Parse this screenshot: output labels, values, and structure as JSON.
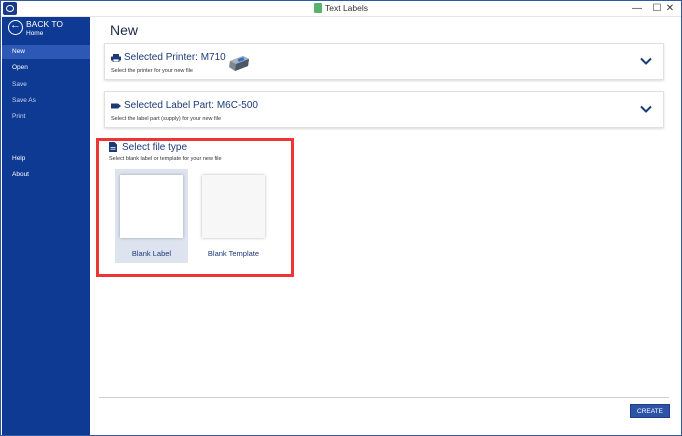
{
  "window": {
    "title": "Text Labels",
    "controls": {
      "minimize": "—",
      "maximize": "☐",
      "close": "✕"
    }
  },
  "sidebar": {
    "back_label": "BACK TO",
    "back_sub": "Home",
    "items": [
      {
        "label": "New",
        "active": true
      },
      {
        "label": "Open",
        "active": false
      },
      {
        "label": "Save",
        "active": false
      },
      {
        "label": "Save As",
        "active": false
      },
      {
        "label": "Print",
        "active": false
      },
      {
        "label": "Help",
        "active": false
      },
      {
        "label": "About",
        "active": false
      }
    ]
  },
  "main": {
    "heading": "New",
    "printer": {
      "title": "Selected Printer: M710",
      "subtitle": "Select the printer for your new file",
      "icon": "printer-icon"
    },
    "label_part": {
      "title": "Selected Label Part: M6C-500",
      "subtitle": "Select the label part (supply) for your new file",
      "icon": "label-part-icon"
    },
    "file_type": {
      "title": "Select file type",
      "subtitle": "Select blank label or template for your new file",
      "options": [
        {
          "label": "Blank Label",
          "selected": true
        },
        {
          "label": "Blank Template",
          "selected": false
        }
      ]
    },
    "create_label": "CREATE"
  },
  "colors": {
    "sidebar_bg": "#0f3a93",
    "accent": "#1b3a78",
    "highlight_border": "#ee3535",
    "create_button": "#2d53a8"
  }
}
